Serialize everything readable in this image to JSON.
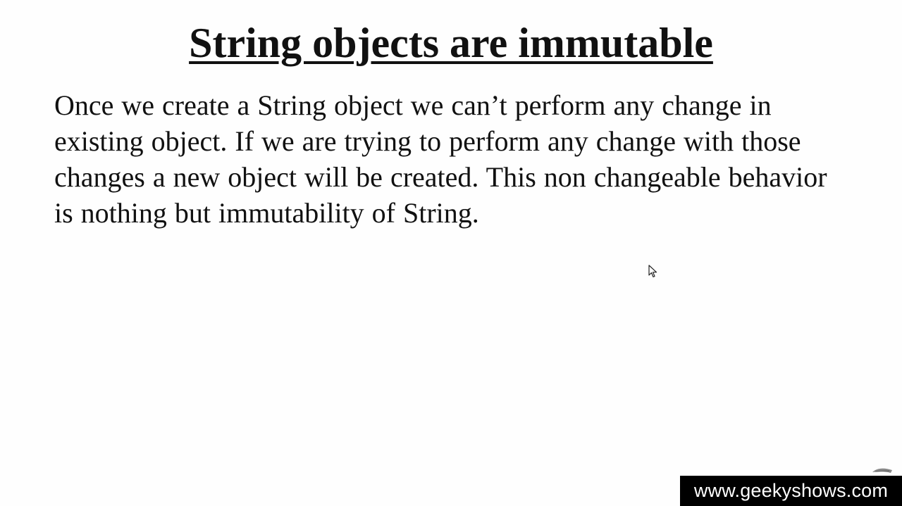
{
  "slide": {
    "title": "String objects are immutable",
    "body": "Once we create a String object we can’t perform any change in existing object. If we are trying to perform any change with those changes a new object will be created. This non changeable behavior is nothing but immutability of String."
  },
  "watermark": {
    "text": "www.geekyshows.com"
  },
  "icons": {
    "cursor": "mouse-pointer-icon",
    "corner": "pen-icon"
  }
}
